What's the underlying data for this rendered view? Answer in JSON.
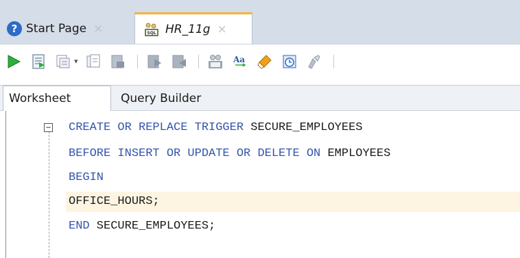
{
  "tabs": {
    "start_page": {
      "label": "Start Page",
      "close": "×",
      "icon": "help-icon"
    },
    "hr": {
      "label": "HR_11g",
      "close": "×",
      "icon": "sql-worksheet-icon"
    }
  },
  "toolbar": {
    "icons": [
      "run-statement-icon",
      "run-script-icon",
      "autotrace-icon",
      "explain-plan-icon",
      "sql-tuning-icon",
      "commit-icon",
      "rollback-icon",
      "unshared-sql-icon",
      "to-upper-lower-icon",
      "clear-icon",
      "history-icon",
      "format-icon"
    ],
    "dropdown_glyph": "▾",
    "colors": {
      "run_green": "#2eae3a",
      "gray_icon": "#8c97a5",
      "clear_orange": "#f0a11b"
    }
  },
  "subtabs": {
    "worksheet": "Worksheet",
    "query_builder": "Query Builder"
  },
  "editor": {
    "fold_glyph": "−",
    "lines": [
      {
        "kw": "CREATE OR REPLACE TRIGGER",
        "id": " SECURE_EMPLOYEES"
      },
      {
        "kw": "BEFORE INSERT OR UPDATE OR DELETE ON",
        "id": " EMPLOYEES"
      },
      {
        "kw": "BEGIN",
        "id": ""
      },
      {
        "kw": "",
        "id": "OFFICE_HOURS;"
      },
      {
        "kw": "END",
        "id": " SECURE_EMPLOYEES;"
      }
    ],
    "colors": {
      "keyword": "#3355aa",
      "identifier": "#1a1a1a",
      "current_line": "#fdf5e2"
    }
  }
}
